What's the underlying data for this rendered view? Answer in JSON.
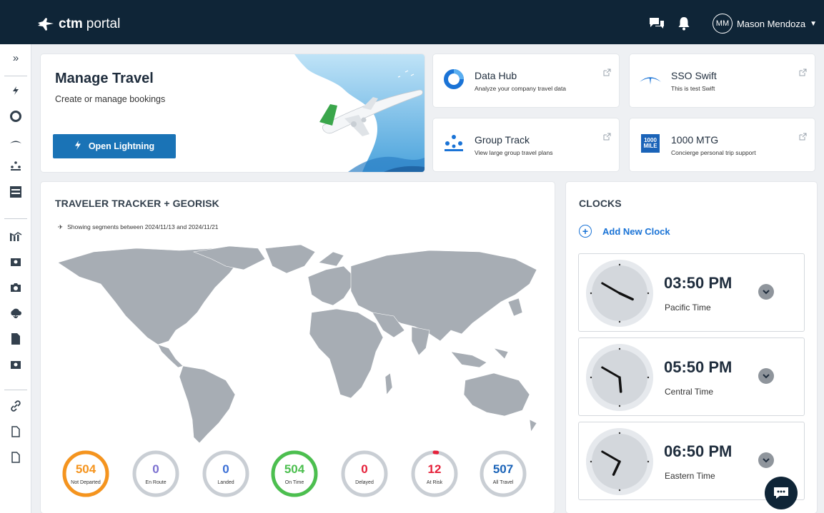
{
  "header": {
    "brand": "ctm",
    "product": "portal",
    "user_initials": "MM",
    "user_name": "Mason Mendoza"
  },
  "sidebar": {
    "items": [
      {
        "icon": "expand-chevrons-icon"
      },
      {
        "icon": "lightning-icon"
      },
      {
        "icon": "data-hub-icon"
      },
      {
        "icon": "swift-icon"
      },
      {
        "icon": "group-track-icon"
      },
      {
        "icon": "1000-mile-icon"
      },
      {
        "icon": "analytics-icon"
      },
      {
        "icon": "travelers-icon"
      },
      {
        "icon": "camera-icon"
      },
      {
        "icon": "cloud-download-icon"
      },
      {
        "icon": "document-icon"
      },
      {
        "icon": "travelers-icon"
      },
      {
        "icon": "link-icon"
      },
      {
        "icon": "file-icon"
      },
      {
        "icon": "file-icon"
      }
    ]
  },
  "manage_travel": {
    "title": "Manage Travel",
    "subtitle": "Create or manage bookings",
    "button_label": "Open Lightning"
  },
  "tiles": [
    {
      "title": "Data Hub",
      "subtitle": "Analyze your company travel data",
      "icon": "data-hub-icon"
    },
    {
      "title": "SSO Swift",
      "subtitle": "This is test Swift",
      "icon": "swift-icon"
    },
    {
      "title": "Group Track",
      "subtitle": "View large group travel plans",
      "icon": "group-track-icon"
    },
    {
      "title": "1000 MTG",
      "subtitle": "Concierge personal trip support",
      "icon": "1000-mile-icon",
      "badge_top": "1000",
      "badge_bottom": "MILE"
    }
  ],
  "tracker": {
    "title": "TRAVELER TRACKER + GEORISK",
    "segment_text": "Showing segments between 2024/11/13 and 2024/11/21",
    "stats": [
      {
        "value": "504",
        "label": "Not Departed",
        "color": "#f5941e",
        "fraction": 1.0
      },
      {
        "value": "0",
        "label": "En Route",
        "color": "#7b6fd0",
        "fraction": 0.0
      },
      {
        "value": "0",
        "label": "Landed",
        "color": "#3b6fd6",
        "fraction": 0.0
      },
      {
        "value": "504",
        "label": "On Time",
        "color": "#4cbf4f",
        "fraction": 1.0
      },
      {
        "value": "0",
        "label": "Delayed",
        "color": "#e5213a",
        "fraction": 0.0
      },
      {
        "value": "12",
        "label": "At Risk",
        "color": "#e5213a",
        "fraction": 0.02
      },
      {
        "value": "507",
        "label": "All Travel",
        "color": "#1a63b8",
        "fraction": 0.0
      }
    ]
  },
  "clocks": {
    "title": "CLOCKS",
    "add_label": "Add New Clock",
    "items": [
      {
        "time": "03:50 PM",
        "zone": "Pacific Time",
        "hour": 15,
        "minute": 50
      },
      {
        "time": "05:50 PM",
        "zone": "Central Time",
        "hour": 17,
        "minute": 50
      },
      {
        "time": "06:50 PM",
        "zone": "Eastern Time",
        "hour": 18,
        "minute": 50
      }
    ]
  },
  "colors": {
    "header_bg": "#0f2537",
    "accent": "#1a73b6",
    "link": "#1a73d6"
  }
}
